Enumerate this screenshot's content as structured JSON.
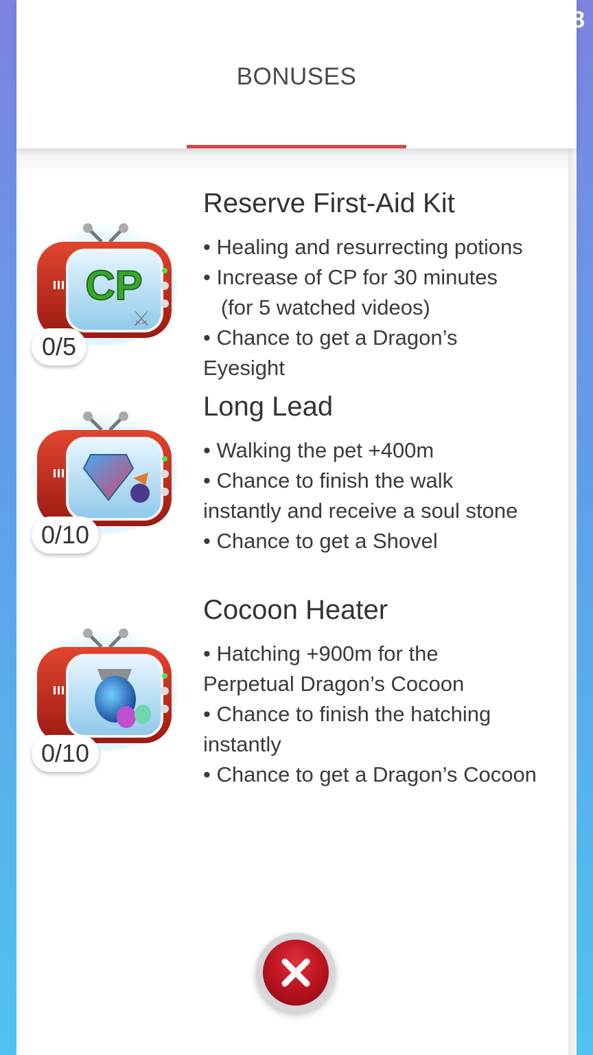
{
  "header": {
    "tab_label": "BONUSES"
  },
  "status_glyph": "8",
  "items": [
    {
      "title": "Reserve First-Aid Kit",
      "description": "• Healing and resurrecting potions\n• Increase of CP for 30 minutes\n   (for 5 watched videos)\n• Chance to get a Dragon’s\nEyesight",
      "counter": "0/5",
      "icon": "tv-cp-icon"
    },
    {
      "title": "Long Lead",
      "description": "• Walking the pet +400m\n• Chance to finish the walk\ninstantly and receive a soul stone\n• Chance to get a Shovel",
      "counter": "0/10",
      "icon": "tv-soul-stone-icon"
    },
    {
      "title": "Cocoon Heater",
      "description": "• Hatching +900m for the\nPerpetual Dragon’s Cocoon\n• Chance to finish the hatching\ninstantly\n• Chance to get a Dragon’s Cocoon",
      "counter": "0/10",
      "icon": "tv-cocoon-icon"
    }
  ],
  "colors": {
    "accent": "#d9474a",
    "close_button": "#b5121d",
    "tv_red": "#c0261c",
    "background_top": "#7d84e0",
    "background_bottom": "#4fc3ef"
  }
}
